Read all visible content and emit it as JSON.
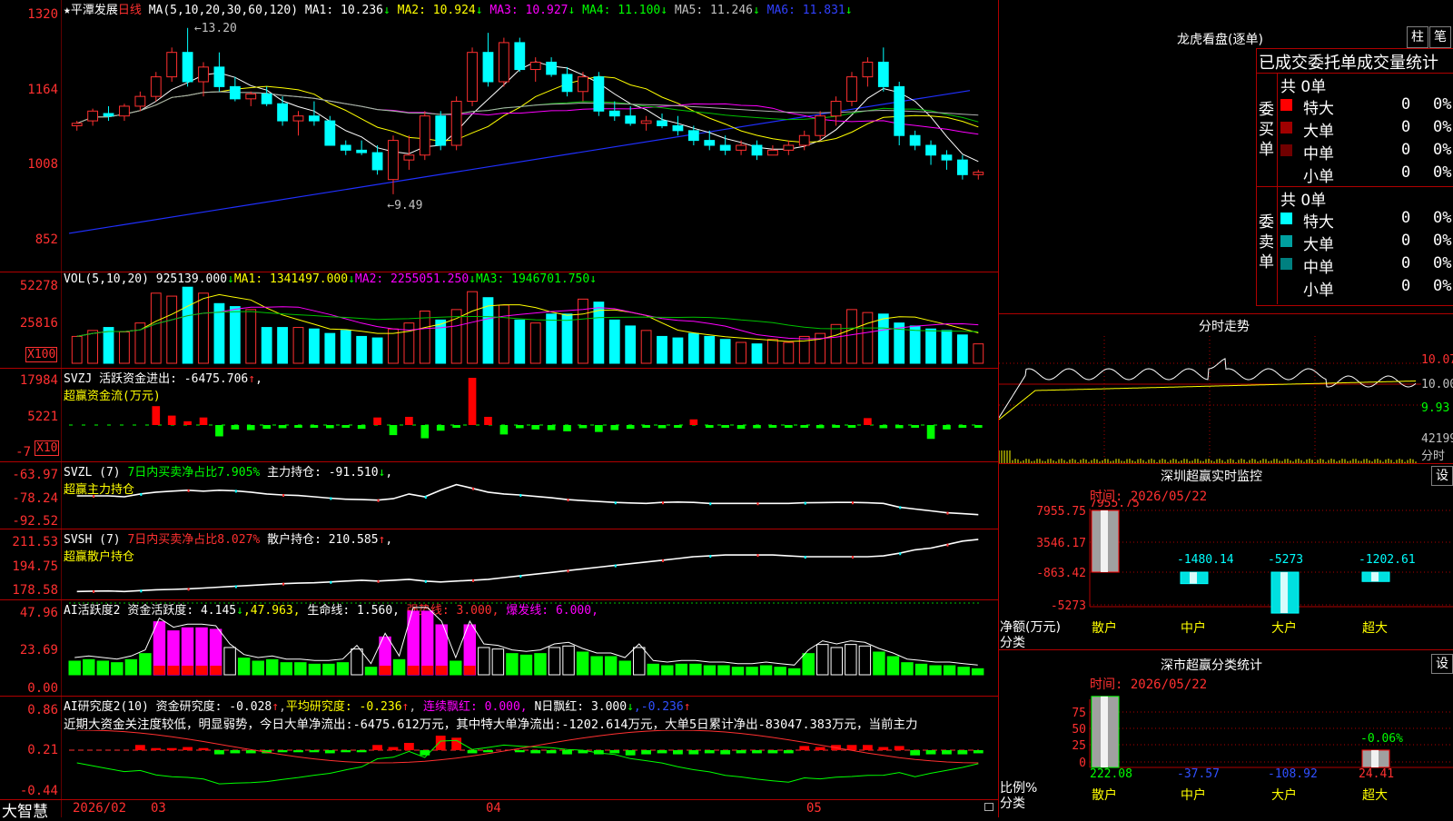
{
  "stock": {
    "star": "★",
    "name": "平潭发展",
    "period": "日线"
  },
  "ma_legend": {
    "label": "MA(5,10,20,30,60,120)",
    "items": [
      {
        "text": "MA1: 10.236",
        "arrow": "↓",
        "color": "#ffffff"
      },
      {
        "text": "MA2: 10.924",
        "arrow": "↓",
        "color": "#ffff00"
      },
      {
        "text": "MA3: 10.927",
        "arrow": "↓",
        "color": "#ff00ff"
      },
      {
        "text": "MA4: 11.100",
        "arrow": "↓",
        "color": "#00ff00"
      },
      {
        "text": "MA5: 11.246",
        "arrow": "↓",
        "color": "#c0c0c0"
      },
      {
        "text": "MA6: 11.831",
        "arrow": "↓",
        "color": "#3040ff"
      }
    ]
  },
  "price_axis": {
    "ticks": [
      "1320",
      "1164",
      "1008",
      "852"
    ]
  },
  "annotations": {
    "high": "13.20",
    "low": "9.49"
  },
  "vol_legend": {
    "label": "VOL(5,10,20)",
    "value": "925139.000",
    "arrow": "↓",
    "ma1": "MA1: 1341497.000",
    "ma1_arrow": "↓",
    "ma2": "MA2: 2255051.250",
    "ma2_arrow": "↓",
    "ma3": "MA3: 1946701.750",
    "ma3_arrow": "↓"
  },
  "vol_axis": {
    "ticks": [
      "52278",
      "25816"
    ],
    "unit": "X100"
  },
  "svzj": {
    "label": "SVZJ",
    "desc": "活跃资金进出: -6475.706",
    "arrow": "↑",
    "comma": ",",
    "sub": "超赢资金流(万元)",
    "ticks": [
      "17984",
      "5221",
      "-7"
    ],
    "unit": "X10"
  },
  "svzl": {
    "label": "SVZL (7)",
    "ratio": "7日内买卖净占比7.905%",
    "hold": "主力持仓: -91.510",
    "arrow": "↓",
    "comma": ",",
    "sub": "超赢主力持仓",
    "ticks": [
      "-63.97",
      "-78.24",
      "-92.52"
    ]
  },
  "svsh": {
    "label": "SVSH (7)",
    "ratio": "7日内买卖净占比8.027%",
    "hold": "散户持仓: 210.585",
    "arrow": "↑",
    "comma": ",",
    "sub": "超赢散户持仓",
    "ticks": [
      "211.53",
      "194.75",
      "178.58"
    ]
  },
  "ai_active": {
    "label": "AI活跃度2",
    "active": "资金活跃度: 4.145",
    "a_arrow": "↓",
    "v2": ",47.963,",
    "life": "生命线: 1.560,",
    "strong": "强势线: 3.000,",
    "burst": "爆发线: 6.000,",
    "ticks": [
      "47.96",
      "23.69",
      "0.00"
    ]
  },
  "ai_research": {
    "label": "AI研究度2(10)",
    "research": "资金研究度: -0.028",
    "r_arrow": "↑",
    "avg": "平均研究度: -0.236",
    "avg_arrow": "↑",
    "lianxu": "连续飘红: 0.000,",
    "nred": "N日飘红: 3.000",
    "n_arrow": "↓",
    "last": ",-0.236",
    "last_arrow": "↑",
    "comment": "近期大资金关注度较低，明显弱势，今日大单净流出:-6475.612万元，其中特大单净流出:-1202.614万元，大单5日累计净出-83047.383万元，当前主力",
    "ticks": [
      "0.86",
      "0.21",
      "-0.44"
    ]
  },
  "date_axis": {
    "brand": "大智慧",
    "labels": [
      "2026/02",
      "03",
      "04",
      "05"
    ]
  },
  "dragon_tiger": {
    "title": "龙虎看盘(逐单)",
    "btn1": "柱",
    "btn2": "笔",
    "header": "已成交委托单成交量统计",
    "buy": {
      "side": "委买单",
      "total": "共 0单",
      "rows": [
        {
          "color": "#ff0000",
          "name": "特大",
          "n": "0",
          "p": "0%"
        },
        {
          "color": "#a00000",
          "name": "大单",
          "n": "0",
          "p": "0%"
        },
        {
          "color": "#700000",
          "name": "中单",
          "n": "0",
          "p": "0%"
        },
        {
          "color": "#000000",
          "name": "小单",
          "n": "0",
          "p": "0%"
        }
      ]
    },
    "sell": {
      "side": "委卖单",
      "total": "共 0单",
      "rows": [
        {
          "color": "#00ffff",
          "name": "特大",
          "n": "0",
          "p": "0%"
        },
        {
          "color": "#00a0a0",
          "name": "大单",
          "n": "0",
          "p": "0%"
        },
        {
          "color": "#008080",
          "name": "中单",
          "n": "0",
          "p": "0%"
        },
        {
          "color": "#000000",
          "name": "小单",
          "n": "0",
          "p": "0%"
        }
      ]
    }
  },
  "intraday": {
    "title": "分时走势",
    "ticks": [
      "10.07",
      "10.00",
      "9.93"
    ],
    "vol_label": "42199",
    "foot": "分时"
  },
  "sz_monitor": {
    "title": "深圳超赢实时监控",
    "btn": "设",
    "time": "时间: 2026/05/22",
    "ticks": [
      "7955.75",
      "3546.17",
      "-863.42",
      "-5273"
    ],
    "ylabel": "净额(万元)",
    "xlabel": "分类",
    "cats": [
      "散户",
      "中户",
      "大户",
      "超大"
    ],
    "vals": [
      "7955.75",
      "-1480.14",
      "-5273",
      "-1202.61"
    ]
  },
  "sz_class": {
    "title": "深市超赢分类统计",
    "btn": "设",
    "time": "时间: 2026/05/22",
    "ticks": [
      "75",
      "50",
      "25",
      "0"
    ],
    "ylabel": "比例%",
    "xlabel": "分类",
    "cats": [
      "散户",
      "中户",
      "大户",
      "超大"
    ],
    "vals": [
      "222.08",
      "-37.57",
      "-108.92",
      "24.41"
    ],
    "top_label": "-0.06%"
  },
  "chart_data": [
    {
      "type": "candlestick",
      "title": "平潭发展 日线",
      "ylim": [
        852,
        1320
      ],
      "x": [
        "2026/02",
        "03",
        "04",
        "05"
      ],
      "ohlc": [
        [
          1100,
          1110,
          1090,
          1105
        ],
        [
          1110,
          1135,
          1100,
          1130
        ],
        [
          1125,
          1140,
          1110,
          1120
        ],
        [
          1120,
          1145,
          1110,
          1140
        ],
        [
          1140,
          1170,
          1130,
          1160
        ],
        [
          1160,
          1210,
          1150,
          1200
        ],
        [
          1200,
          1260,
          1190,
          1250
        ],
        [
          1250,
          1300,
          1180,
          1190
        ],
        [
          1190,
          1230,
          1160,
          1220
        ],
        [
          1220,
          1250,
          1170,
          1180
        ],
        [
          1180,
          1200,
          1150,
          1155
        ],
        [
          1155,
          1170,
          1140,
          1165
        ],
        [
          1165,
          1180,
          1140,
          1145
        ],
        [
          1145,
          1160,
          1100,
          1110
        ],
        [
          1110,
          1130,
          1080,
          1120
        ],
        [
          1120,
          1150,
          1100,
          1110
        ],
        [
          1110,
          1120,
          1060,
          1060
        ],
        [
          1060,
          1070,
          1040,
          1050
        ],
        [
          1050,
          1070,
          1040,
          1045
        ],
        [
          1045,
          1060,
          1000,
          1010
        ],
        [
          990,
          1080,
          960,
          1070
        ],
        [
          1030,
          1080,
          1010,
          1040
        ],
        [
          1040,
          1130,
          1030,
          1120
        ],
        [
          1120,
          1130,
          1050,
          1060
        ],
        [
          1060,
          1160,
          1050,
          1150
        ],
        [
          1150,
          1260,
          1140,
          1250
        ],
        [
          1250,
          1290,
          1180,
          1190
        ],
        [
          1190,
          1280,
          1180,
          1270
        ],
        [
          1270,
          1280,
          1210,
          1215
        ],
        [
          1215,
          1240,
          1190,
          1230
        ],
        [
          1230,
          1240,
          1200,
          1205
        ],
        [
          1205,
          1220,
          1160,
          1170
        ],
        [
          1170,
          1210,
          1150,
          1200
        ],
        [
          1200,
          1210,
          1120,
          1130
        ],
        [
          1130,
          1150,
          1110,
          1120
        ],
        [
          1120,
          1140,
          1100,
          1105
        ],
        [
          1105,
          1120,
          1090,
          1110
        ],
        [
          1110,
          1125,
          1095,
          1100
        ],
        [
          1100,
          1120,
          1080,
          1090
        ],
        [
          1090,
          1100,
          1060,
          1070
        ],
        [
          1070,
          1090,
          1050,
          1060
        ],
        [
          1060,
          1080,
          1040,
          1050
        ],
        [
          1050,
          1070,
          1040,
          1060
        ],
        [
          1060,
          1070,
          1030,
          1040
        ],
        [
          1040,
          1060,
          1040,
          1050
        ],
        [
          1050,
          1070,
          1040,
          1060
        ],
        [
          1060,
          1090,
          1050,
          1080
        ],
        [
          1080,
          1130,
          1070,
          1120
        ],
        [
          1120,
          1160,
          1100,
          1150
        ],
        [
          1150,
          1210,
          1140,
          1200
        ],
        [
          1200,
          1240,
          1180,
          1230
        ],
        [
          1230,
          1260,
          1170,
          1180
        ],
        [
          1180,
          1190,
          1060,
          1080
        ],
        [
          1080,
          1090,
          1050,
          1060
        ],
        [
          1060,
          1070,
          1020,
          1040
        ],
        [
          1040,
          1050,
          1010,
          1030
        ],
        [
          1030,
          1040,
          990,
          1000
        ],
        [
          1000,
          1010,
          990,
          1005
        ]
      ]
    },
    {
      "type": "bar",
      "title": "VOL(5,10,20)",
      "ylim": [
        0,
        56000
      ],
      "values": [
        18000,
        22000,
        24000,
        21000,
        27000,
        47000,
        45000,
        51000,
        47000,
        40000,
        38000,
        36000,
        24000,
        24000,
        24000,
        23000,
        20000,
        22000,
        18000,
        17000,
        23000,
        27000,
        35000,
        29000,
        36000,
        48000,
        44000,
        39000,
        29000,
        27000,
        33000,
        33000,
        43000,
        41000,
        29000,
        25000,
        22000,
        18000,
        17000,
        20000,
        18000,
        16000,
        14000,
        13000,
        16000,
        14000,
        18000,
        20000,
        26000,
        36000,
        34000,
        33000,
        27000,
        25000,
        23000,
        22000,
        19000,
        13000
      ]
    },
    {
      "type": "bar",
      "title": "SVZJ",
      "ylim": [
        -7,
        17984
      ],
      "values": [
        0,
        0,
        0,
        0,
        0,
        3000,
        1500,
        600,
        1200,
        -1800,
        -700,
        -800,
        -600,
        -500,
        -400,
        -300,
        -500,
        -400,
        -600,
        1200,
        -1600,
        1300,
        -2100,
        -900,
        -200,
        7500,
        1300,
        -1500,
        -500,
        -700,
        -800,
        -1000,
        -500,
        -1100,
        -800,
        -600,
        -400,
        -500,
        -200,
        900,
        -400,
        -300,
        -600,
        -500,
        -300,
        -400,
        -300,
        -500,
        -400,
        -200,
        1100,
        -500,
        -500,
        -400,
        -2200,
        -700,
        -400,
        -200
      ]
    },
    {
      "type": "line",
      "title": "SVZL (7)",
      "ylim": [
        -92.52,
        -63.97
      ],
      "values": [
        -78,
        -78,
        -78,
        -78.5,
        -77,
        -76,
        -75.5,
        -75,
        -75.5,
        -75,
        -75.3,
        -76,
        -77,
        -77.5,
        -77.8,
        -78.5,
        -79.2,
        -79.8,
        -80,
        -80.3,
        -79.5,
        -77,
        -78.5,
        -75,
        -72,
        -74,
        -76,
        -77,
        -77.5,
        -78.3,
        -79,
        -80,
        -80.5,
        -81,
        -81.5,
        -81.8,
        -82,
        -81.5,
        -81.3,
        -81.5,
        -82,
        -82,
        -82,
        -82,
        -82,
        -82,
        -81.7,
        -81.6,
        -81.5,
        -81.5,
        -81.7,
        -82,
        -84,
        -85,
        -86,
        -87,
        -87.5,
        -88
      ]
    },
    {
      "type": "line",
      "title": "SVSH (7)",
      "ylim": [
        178.58,
        211.53
      ],
      "values": [
        180,
        180.2,
        180.3,
        180,
        180.5,
        181,
        181.2,
        181.5,
        182,
        182.5,
        183,
        183.5,
        184,
        184.5,
        184.8,
        185,
        185.5,
        186,
        186.5,
        186,
        186.5,
        187,
        186,
        185.5,
        186,
        186.5,
        187,
        188,
        189,
        190,
        191,
        192,
        193,
        194,
        195,
        196,
        197,
        198,
        199,
        200,
        200.5,
        201,
        201,
        201,
        201,
        200.5,
        200,
        200,
        200,
        200,
        200,
        200.5,
        202,
        204,
        205,
        207,
        209,
        210
      ]
    },
    {
      "type": "bar",
      "title": "AI活跃度2",
      "ylim": [
        0,
        47.96
      ],
      "values": [
        9,
        10,
        9,
        8,
        10,
        14,
        35,
        29,
        31,
        31,
        30,
        18,
        11,
        9,
        10,
        8,
        8,
        7,
        7,
        8,
        17,
        5,
        25,
        10,
        42,
        42,
        33,
        9,
        33,
        18,
        17,
        14,
        13,
        14,
        18,
        19,
        15,
        12,
        12,
        9,
        18,
        7,
        6,
        7,
        7,
        6,
        6,
        5,
        5,
        6,
        5,
        4,
        14,
        20,
        18,
        20,
        19,
        15,
        12,
        8,
        7,
        6,
        6,
        5,
        4
      ]
    },
    {
      "type": "bar",
      "title": "AI研究度2(10)",
      "ylim": [
        -0.44,
        0.86
      ],
      "values": [
        0,
        0,
        0,
        0,
        0.05,
        0.02,
        0.02,
        0.03,
        0.02,
        -0.04,
        -0.03,
        -0.03,
        -0.03,
        -0.02,
        -0.02,
        -0.02,
        -0.03,
        -0.02,
        -0.02,
        0.05,
        0.03,
        0.07,
        -0.05,
        0.14,
        0.12,
        -0.03,
        -0.02,
        0,
        -0.02,
        -0.03,
        -0.03,
        -0.04,
        -0.03,
        -0.04,
        -0.03,
        -0.05,
        -0.04,
        -0.03,
        -0.04,
        -0.04,
        -0.03,
        -0.04,
        -0.03,
        -0.03,
        -0.03,
        -0.03,
        0.04,
        0.03,
        0.05,
        0.05,
        0.05,
        0.03,
        0.04,
        -0.05,
        -0.04,
        -0.04,
        -0.04,
        -0.03
      ]
    },
    {
      "type": "bar",
      "title": "深圳超赢实时监控",
      "categories": [
        "散户",
        "中户",
        "大户",
        "超大"
      ],
      "values": [
        7955.75,
        -1480.14,
        -5273,
        -1202.61
      ],
      "ylim": [
        -5273,
        7955.75
      ],
      "ylabel": "净额(万元)",
      "xlabel": "分类"
    },
    {
      "type": "bar",
      "title": "深市超赢分类统计",
      "categories": [
        "散户",
        "中户",
        "大户",
        "超大"
      ],
      "values": [
        222.08,
        -37.57,
        -108.92,
        24.41
      ],
      "ylim": [
        0,
        75
      ],
      "ylabel": "比例%",
      "xlabel": "分类"
    }
  ]
}
